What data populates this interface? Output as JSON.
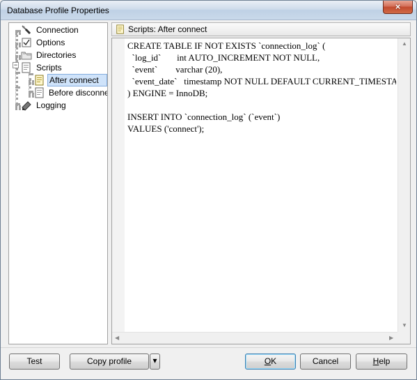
{
  "window": {
    "title": "Database Profile Properties",
    "close_glyph": "×"
  },
  "tree": {
    "items": [
      {
        "label": "Connection",
        "icon": "connection-icon"
      },
      {
        "label": "Options",
        "icon": "options-icon"
      },
      {
        "label": "Directories",
        "icon": "directories-icon"
      },
      {
        "label": "Scripts",
        "icon": "scripts-icon",
        "expander": "−"
      },
      {
        "label": "After connect",
        "icon": "script-file-icon",
        "selected": true
      },
      {
        "label": "Before disconnect",
        "icon": "script-file-icon"
      },
      {
        "label": "Logging",
        "icon": "logging-icon"
      }
    ]
  },
  "panel": {
    "header": "Scripts: After connect",
    "code": "CREATE TABLE IF NOT EXISTS `connection_log` (\n  `log_id`       int AUTO_INCREMENT NOT NULL,\n  `event`        varchar (20),\n  `event_date`   timestamp NOT NULL DEFAULT CURRENT_TIMESTAMP,\n) ENGINE = InnoDB;\n\nINSERT INTO `connection_log` (`event`)\nVALUES ('connect');"
  },
  "buttons": {
    "test": "Test",
    "copy_profile": "Copy profile",
    "dropdown_glyph": "▾",
    "ok_mnemonic": "O",
    "ok_rest": "K",
    "cancel": "Cancel",
    "help_mnemonic": "H",
    "help_rest": "elp"
  },
  "colors": {
    "accent": "#3c7fb1",
    "selection": "#cfe3fa"
  }
}
